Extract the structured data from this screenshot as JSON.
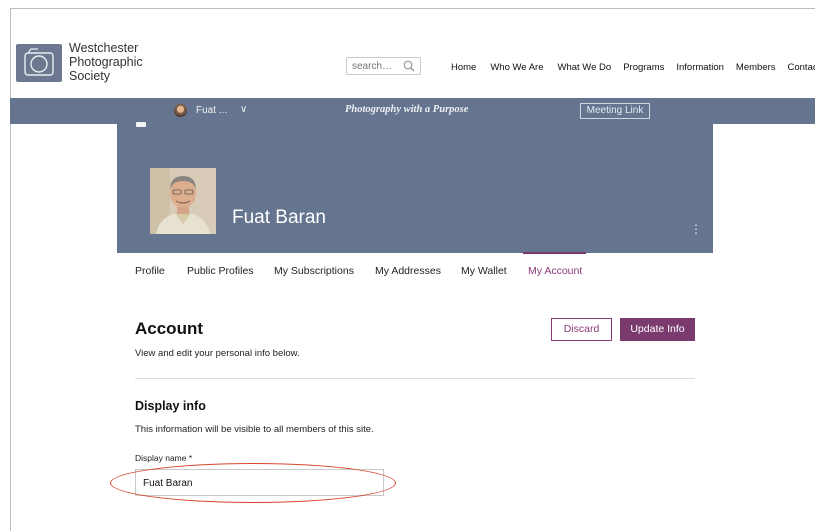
{
  "header": {
    "logo_lines": [
      "Westchester",
      "Photographic",
      "Society"
    ],
    "search": {
      "placeholder": "search…"
    },
    "nav": [
      "Home",
      "Who We Are",
      "What We Do",
      "Programs",
      "Information",
      "Members",
      "Contact"
    ]
  },
  "topbar": {
    "user_name": "Fuat ...",
    "chevron": "∨",
    "tagline": "Photography with a Purpose",
    "meeting_link": "Meeting Link"
  },
  "profile": {
    "name": "Fuat Baran",
    "more": "⋮"
  },
  "tabs": [
    "Profile",
    "Public Profiles",
    "My Subscriptions",
    "My Addresses",
    "My Wallet",
    "My Account"
  ],
  "active_tab": "My Account",
  "account": {
    "title": "Account",
    "subtitle": "View and edit your personal info below.",
    "discard_label": "Discard",
    "update_label": "Update Info"
  },
  "display_info": {
    "title": "Display info",
    "subtitle": "This information will be visible to all members of this site.",
    "field_label": "Display name *",
    "field_value": "Fuat Baran"
  },
  "colors": {
    "bar": "#65758f",
    "accent": "#7a3a6e",
    "highlight": "#d8452e"
  },
  "icons": [
    "camera-logo-icon",
    "search-icon",
    "chevron-down-icon",
    "more-vertical-icon"
  ]
}
